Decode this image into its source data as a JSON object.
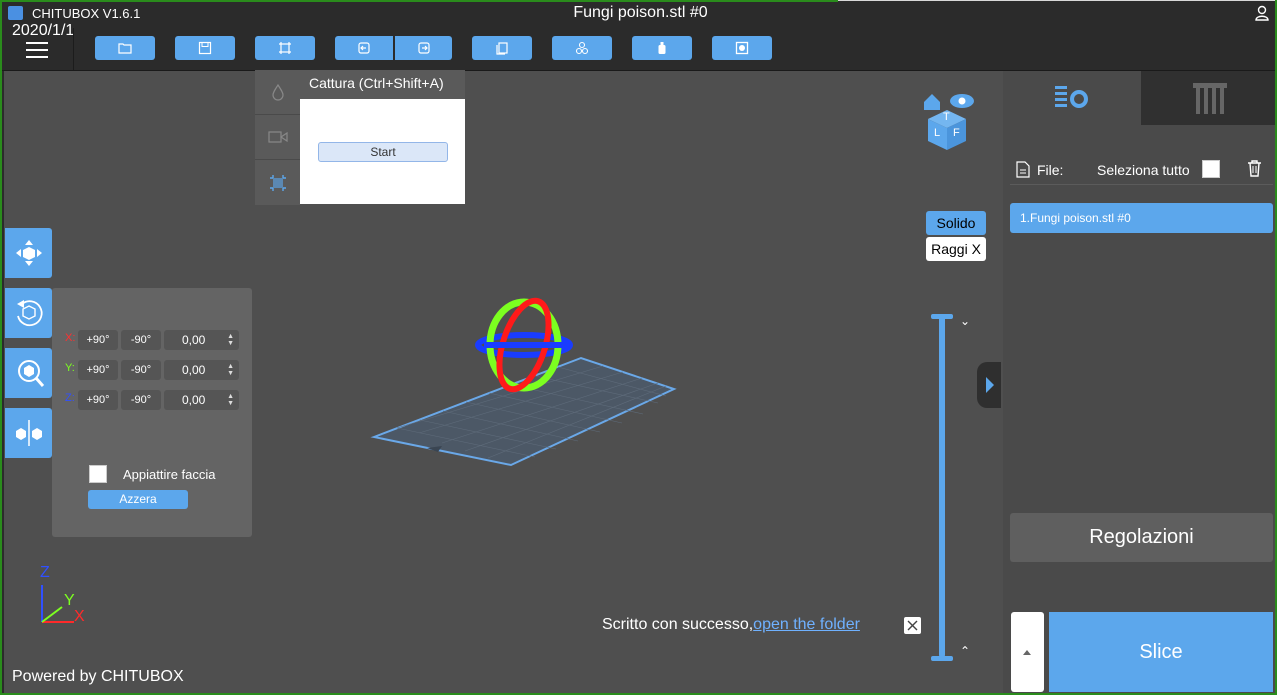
{
  "window": {
    "app_title": "CHITUBOX V1.6.1",
    "doc_title": "Fungi poison.stl #0",
    "date": "2020/1/1"
  },
  "capture": {
    "title": "Cattura (Ctrl+Shift+A)",
    "start_label": "Start"
  },
  "rotation": {
    "rows": [
      {
        "axis": "X:",
        "plus": "+90°",
        "minus": "-90°",
        "value": "0,00",
        "color": "#ff3030"
      },
      {
        "axis": "Y:",
        "plus": "+90°",
        "minus": "-90°",
        "value": "0,00",
        "color": "#7cff20"
      },
      {
        "axis": "Z:",
        "plus": "+90°",
        "minus": "-90°",
        "value": "0,00",
        "color": "#3050ff"
      }
    ],
    "flatten_label": "Appiattire faccia",
    "reset_label": "Azzera"
  },
  "viewport": {
    "powered_by": "Powered by CHITUBOX",
    "toast_text": "Scritto con successo,",
    "toast_link": "open the folder",
    "view_solid": "Solido",
    "view_xray": "Raggi X",
    "axes": {
      "z": "Z",
      "y": "Y",
      "x": "X"
    },
    "cube_faces": {
      "top": "T",
      "left": "L",
      "front": "F"
    }
  },
  "panel": {
    "file_label": "File:",
    "select_all_label": "Seleziona tutto",
    "files": [
      "1.Fungi poison.stl #0"
    ],
    "adjust_label": "Regolazioni",
    "slice_label": "Slice"
  },
  "colors": {
    "accent": "#5ca7ec",
    "gizmo_red": "#ff1a1a",
    "gizmo_green": "#7cff20",
    "gizmo_blue": "#1a3cff"
  }
}
